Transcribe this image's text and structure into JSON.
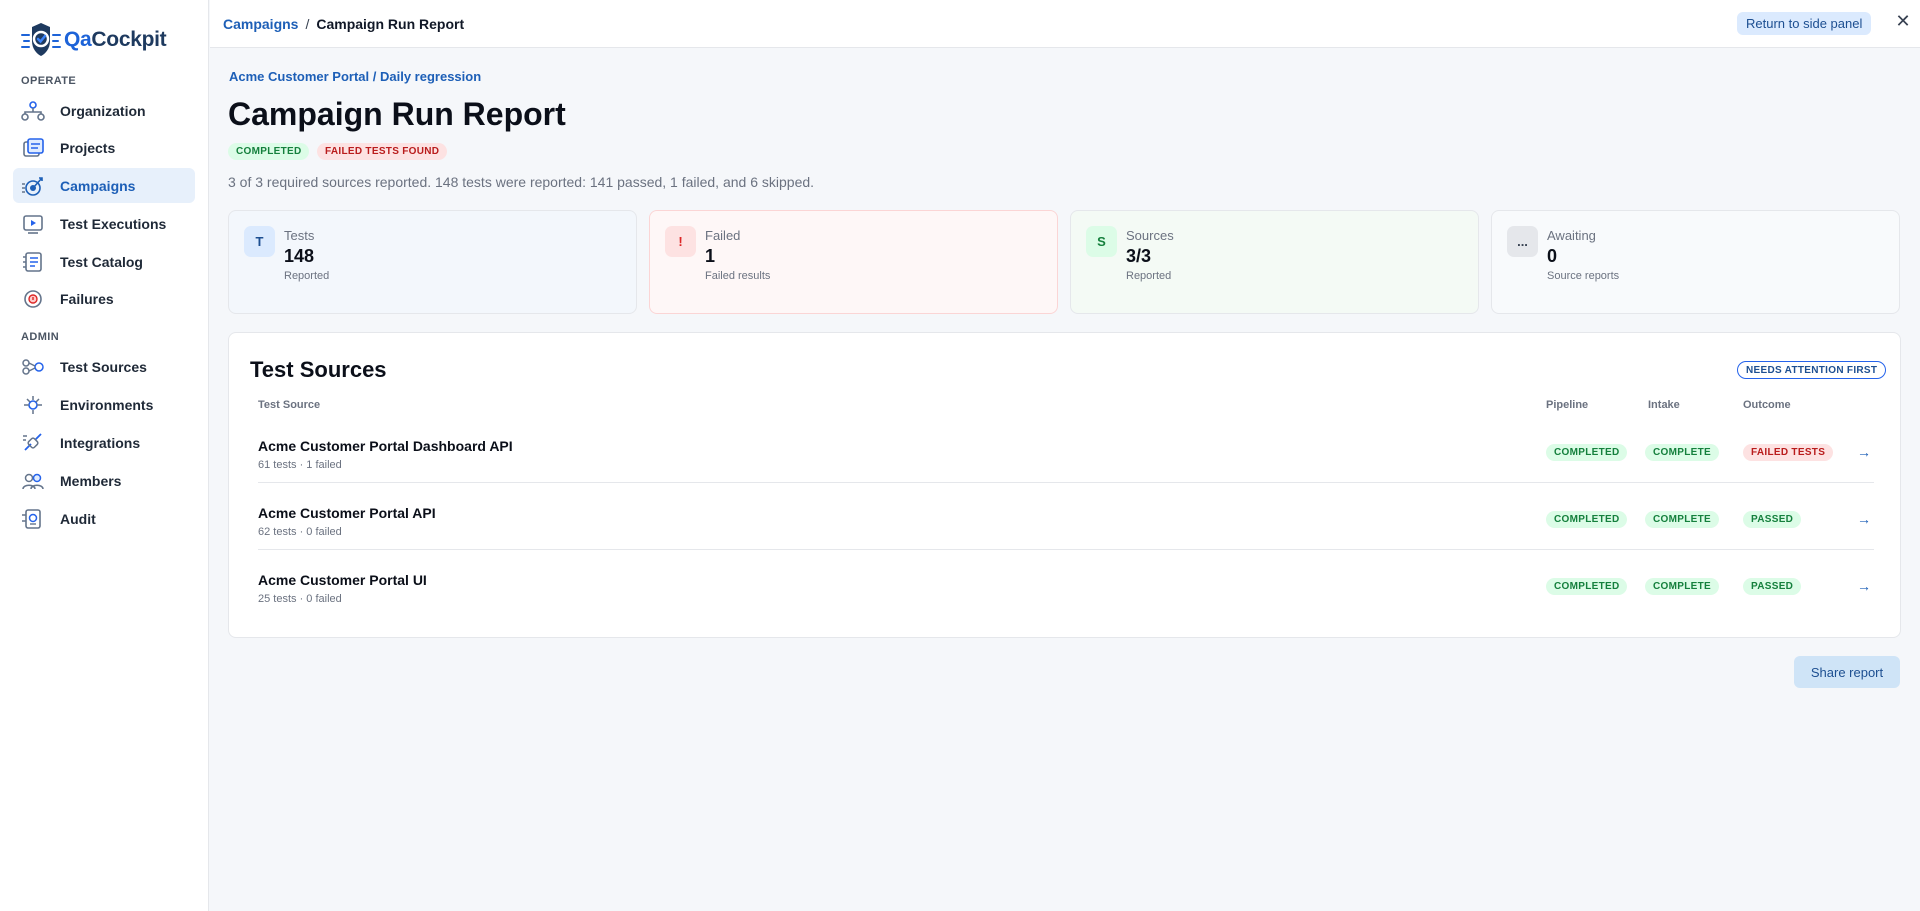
{
  "app": {
    "logo_prefix": "Qa",
    "logo_suffix": "Cockpit"
  },
  "sidebar": {
    "sections": [
      {
        "label": "OPERATE"
      },
      {
        "label": "ADMIN"
      }
    ],
    "items": [
      {
        "label": "Organization",
        "icon": "organization-icon"
      },
      {
        "label": "Projects",
        "icon": "projects-icon"
      },
      {
        "label": "Campaigns",
        "icon": "campaigns-icon",
        "active": true
      },
      {
        "label": "Test Executions",
        "icon": "test-executions-icon"
      },
      {
        "label": "Test Catalog",
        "icon": "test-catalog-icon"
      },
      {
        "label": "Failures",
        "icon": "failures-icon"
      },
      {
        "label": "Test Sources",
        "icon": "test-sources-icon"
      },
      {
        "label": "Environments",
        "icon": "environments-icon"
      },
      {
        "label": "Integrations",
        "icon": "integrations-icon"
      },
      {
        "label": "Members",
        "icon": "members-icon"
      },
      {
        "label": "Audit",
        "icon": "audit-icon"
      }
    ]
  },
  "topbar": {
    "breadcrumb_link": "Campaigns",
    "breadcrumb_sep": "/",
    "breadcrumb_current": "Campaign Run Report",
    "return_label": "Return to side panel",
    "close_glyph": "✕"
  },
  "main": {
    "subcrumb": "Acme Customer Portal / Daily regression",
    "title": "Campaign Run Report",
    "badges": [
      "COMPLETED",
      "FAILED TESTS FOUND"
    ],
    "summary": "3 of 3 required sources reported. 148 tests were reported: 141 passed, 1 failed, and 6 skipped.",
    "cards": [
      {
        "icon": "T",
        "label": "Tests",
        "value": "148",
        "sub": "Reported"
      },
      {
        "icon": "!",
        "label": "Failed",
        "value": "1",
        "sub": "Failed results"
      },
      {
        "icon": "S",
        "label": "Sources",
        "value": "3/3",
        "sub": "Reported"
      },
      {
        "icon": "...",
        "label": "Awaiting",
        "value": "0",
        "sub": "Source reports"
      }
    ],
    "sources": {
      "title": "Test Sources",
      "sort_badge": "NEEDS ATTENTION FIRST",
      "columns": [
        "Test Source",
        "Pipeline",
        "Intake",
        "Outcome"
      ],
      "rows": [
        {
          "name": "Acme Customer Portal Dashboard API",
          "meta": "61 tests · 1 failed",
          "pipeline": "COMPLETED",
          "intake": "COMPLETE",
          "outcome": "FAILED TESTS",
          "arrow": "→"
        },
        {
          "name": "Acme Customer Portal API",
          "meta": "62 tests · 0 failed",
          "pipeline": "COMPLETED",
          "intake": "COMPLETE",
          "outcome": "PASSED",
          "arrow": "→"
        },
        {
          "name": "Acme Customer Portal UI",
          "meta": "25 tests · 0 failed",
          "pipeline": "COMPLETED",
          "intake": "COMPLETE",
          "outcome": "PASSED",
          "arrow": "→"
        }
      ]
    },
    "share_label": "Share report"
  },
  "colors": {
    "accent": "#1d5fb7",
    "success_bg": "#dcfce7",
    "success_text": "#15803d",
    "danger_bg": "#fde2e2",
    "danger_text": "#b91c1c"
  }
}
